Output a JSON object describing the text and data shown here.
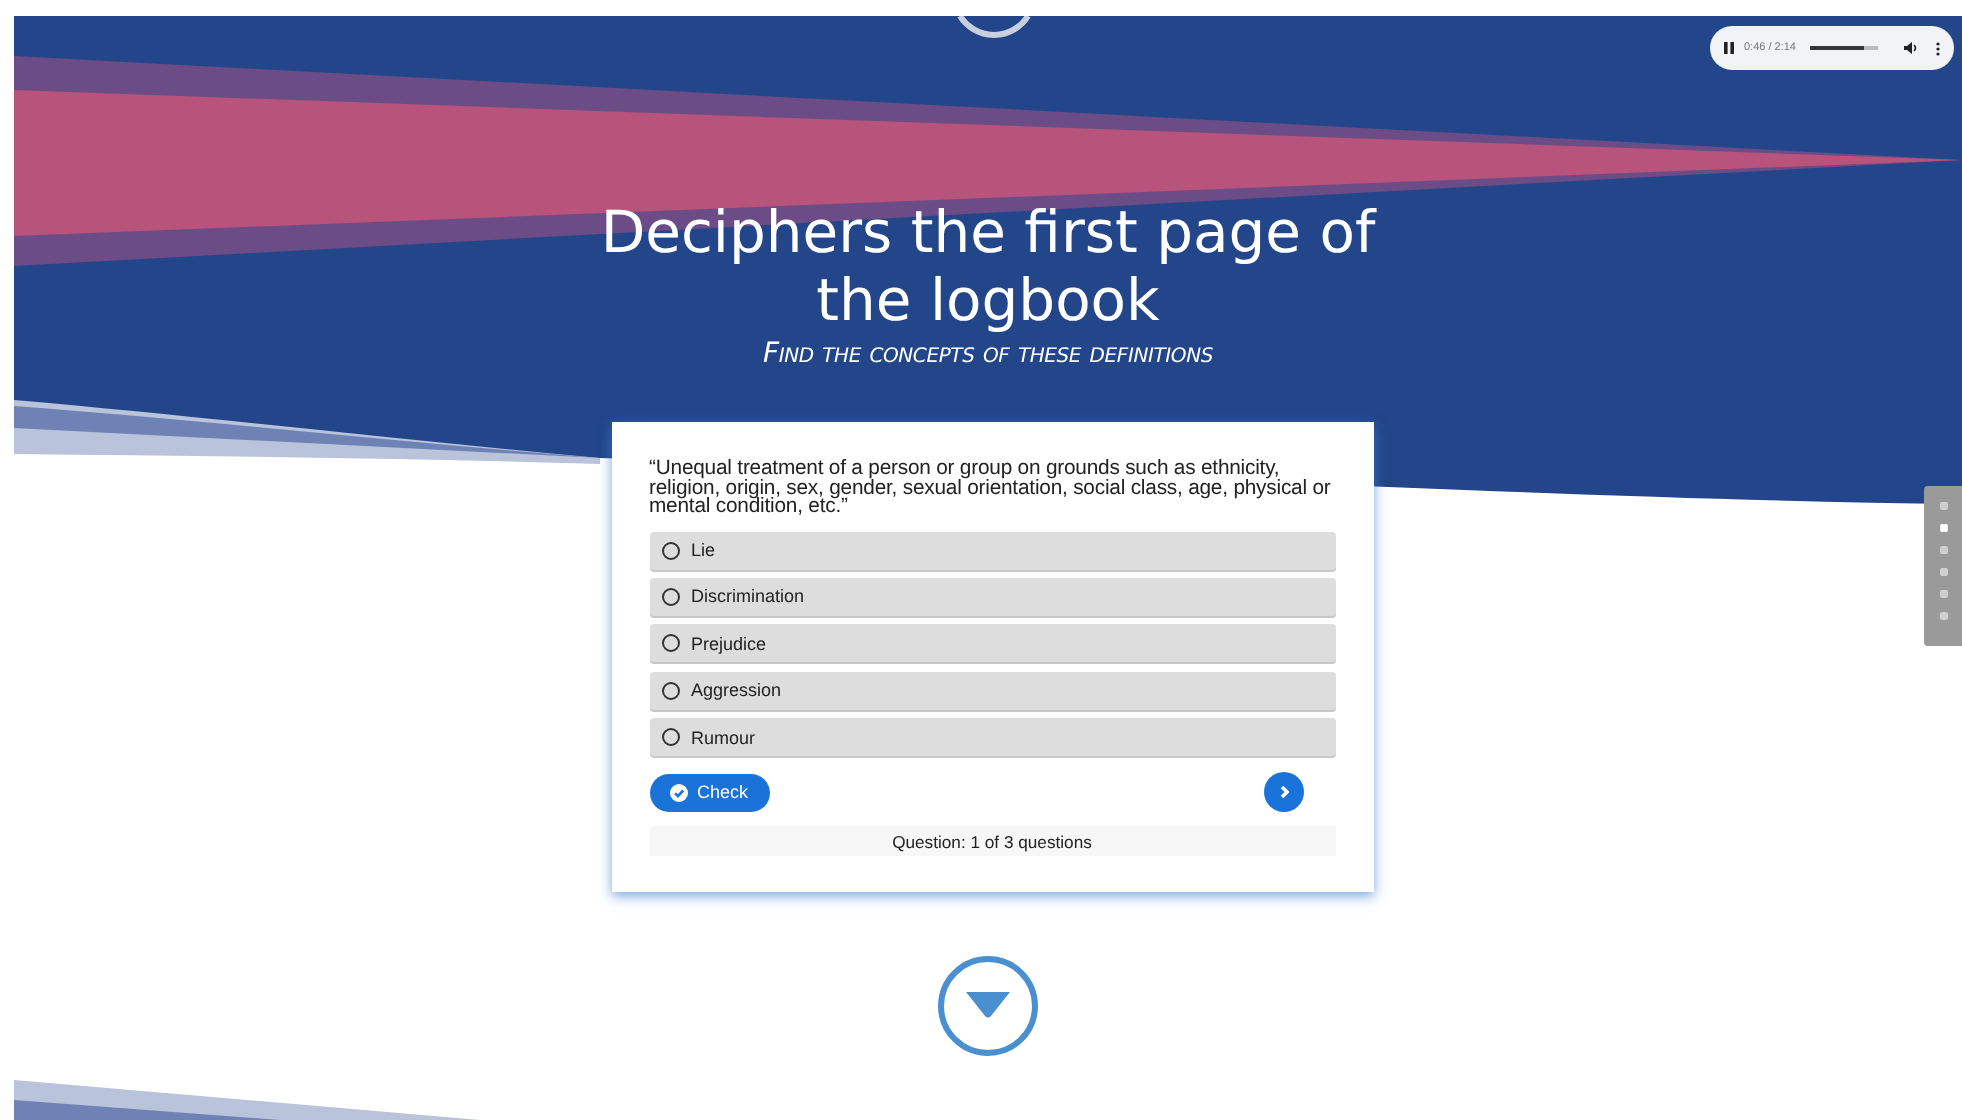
{
  "audio_player": {
    "playing": true,
    "time": "0:46 / 2:14",
    "level": 0.78
  },
  "header": {
    "title": "Deciphers the first page of the logbook",
    "subtitle": "Find the concepts of these definitions"
  },
  "quiz": {
    "question": "“Unequal treatment of a person or group on grounds such as ethnicity, religion, origin, sex, gender, sexual orientation, social class, age, physical or mental condition, etc.”",
    "options": [
      {
        "label": "Lie",
        "selected": false
      },
      {
        "label": "Discrimination",
        "selected": false
      },
      {
        "label": "Prejudice",
        "selected": false
      },
      {
        "label": "Aggression",
        "selected": false
      },
      {
        "label": "Rumour",
        "selected": false
      }
    ],
    "check_button": "Check",
    "progress": "Question: 1 of 3 questions"
  },
  "side_nav": [
    {
      "selected": false
    },
    {
      "selected": true
    },
    {
      "selected": false
    },
    {
      "selected": false
    },
    {
      "selected": false
    },
    {
      "selected": false
    }
  ]
}
